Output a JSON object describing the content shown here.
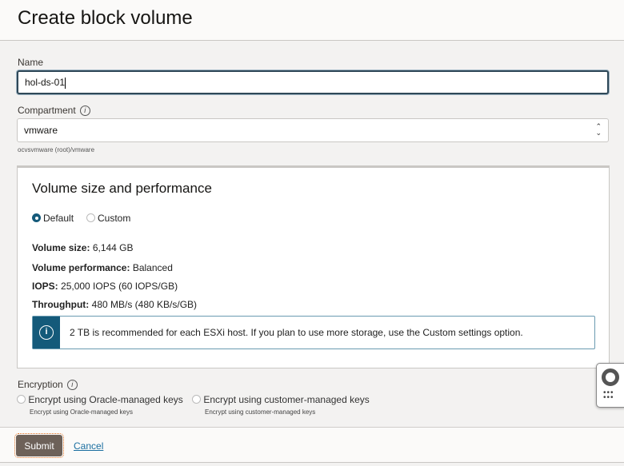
{
  "header": {
    "title": "Create block volume"
  },
  "name": {
    "label": "Name",
    "value": "hol-ds-01"
  },
  "compartment": {
    "label": "Compartment",
    "info": "i",
    "value": "vmware",
    "path": "ocvsvmware (root)/vmware"
  },
  "volume": {
    "title": "Volume size and performance",
    "options": [
      {
        "label": "Default",
        "selected": true
      },
      {
        "label": "Custom",
        "selected": false
      }
    ],
    "details": [
      {
        "key": "Volume size:",
        "value": "6,144 GB"
      },
      {
        "key": "Volume performance:",
        "value": "Balanced"
      },
      {
        "key": "IOPS:",
        "value": "25,000 IOPS (60 IOPS/GB)"
      },
      {
        "key": "Throughput:",
        "value": "480 MB/s (480 KB/s/GB)"
      }
    ],
    "alert": "2 TB is recommended for each ESXi host. If you plan to use more storage, use the Custom settings option."
  },
  "encryption": {
    "label": "Encryption",
    "info": "i",
    "options": [
      {
        "label": "Encrypt using Oracle-managed keys",
        "sub": "Encrypt using Oracle-managed keys"
      },
      {
        "label": "Encrypt using customer-managed keys",
        "sub": "Encrypt using customer-managed keys"
      }
    ]
  },
  "footer": {
    "submit": "Submit",
    "cancel": "Cancel"
  },
  "colors": {
    "accent": "#145a7a",
    "submit": "#6d6159",
    "link": "#1a6ea0"
  }
}
